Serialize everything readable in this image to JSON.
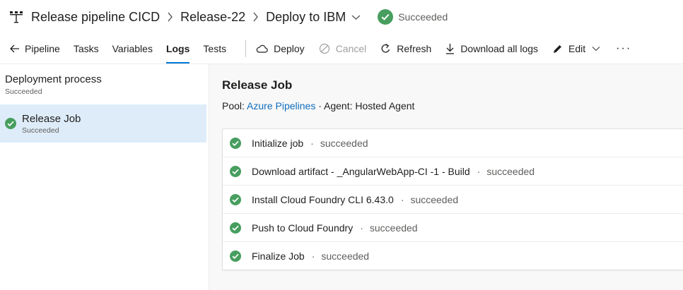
{
  "header": {
    "pipeline_name": "Release pipeline CICD",
    "release_name": "Release-22",
    "stage_name": "Deploy to IBM",
    "status": "Succeeded",
    "status_color": "#479e5f"
  },
  "toolbar": {
    "back_label": "Pipeline",
    "tabs": [
      {
        "label": "Tasks"
      },
      {
        "label": "Variables"
      },
      {
        "label": "Logs"
      },
      {
        "label": "Tests"
      }
    ],
    "active_tab": "Logs",
    "actions": {
      "deploy": "Deploy",
      "cancel": "Cancel",
      "refresh": "Refresh",
      "download": "Download all logs",
      "edit": "Edit"
    },
    "more": "···"
  },
  "sidebar": {
    "section_title": "Deployment process",
    "section_status": "Succeeded",
    "items": [
      {
        "title": "Release Job",
        "status": "Succeeded"
      }
    ]
  },
  "job": {
    "title": "Release Job",
    "pool_label": "Pool:",
    "pool_value": "Azure Pipelines",
    "agent_label": "· Agent: Hosted Agent",
    "bullet": "·",
    "steps": [
      {
        "name": "Initialize job",
        "state": "succeeded"
      },
      {
        "name": "Download artifact - _AngularWebApp-CI -1 - Build",
        "state": "succeeded"
      },
      {
        "name": "Install Cloud Foundry CLI 6.43.0",
        "state": "succeeded"
      },
      {
        "name": "Push to Cloud Foundry",
        "state": "succeeded"
      },
      {
        "name": "Finalize Job",
        "state": "succeeded"
      }
    ]
  },
  "icons": {
    "pipeline": "release-pipeline-icon",
    "breadcrumb_separator": "chevron-right-icon",
    "dropdown": "chevron-down-icon",
    "success": "check-circle-icon",
    "back": "arrow-left-icon",
    "deploy": "cloud-icon",
    "cancel": "cancel-circle-icon",
    "refresh": "refresh-icon",
    "download": "download-icon",
    "edit": "pencil-icon"
  },
  "colors": {
    "accent": "#0078d4",
    "link": "#106ebe",
    "success": "#479e5f",
    "selected_bg": "#deecf9"
  }
}
